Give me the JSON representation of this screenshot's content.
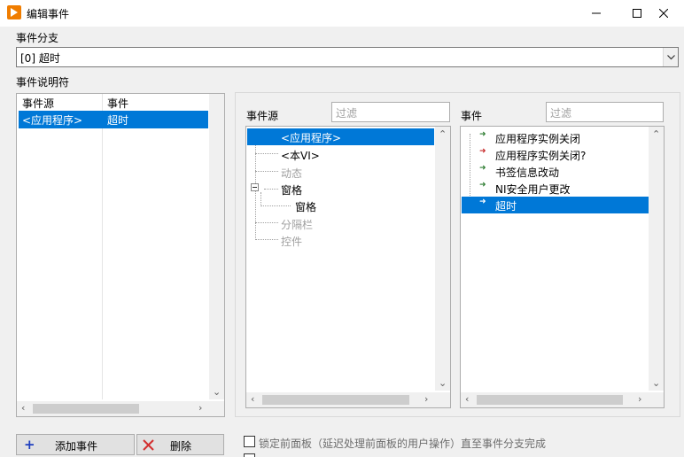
{
  "window": {
    "title": "编辑事件"
  },
  "event_case": {
    "label": "事件分支",
    "value": "[0] 超时"
  },
  "specifiers": {
    "label": "事件说明符",
    "col_source": "事件源",
    "col_event": "事件",
    "rows": [
      {
        "source": "<应用程序>",
        "event": "超时"
      }
    ]
  },
  "sources": {
    "label": "事件源",
    "filter_placeholder": "过滤",
    "items": [
      {
        "label": "<应用程序>",
        "selected": true,
        "dimmed": false
      },
      {
        "label": "<本VI>",
        "selected": false,
        "dimmed": false
      },
      {
        "label": "动态",
        "selected": false,
        "dimmed": true
      },
      {
        "label": "窗格",
        "selected": false,
        "dimmed": false
      },
      {
        "label": "窗格",
        "selected": false,
        "dimmed": false
      },
      {
        "label": "分隔栏",
        "selected": false,
        "dimmed": true
      },
      {
        "label": "控件",
        "selected": false,
        "dimmed": true
      }
    ]
  },
  "events": {
    "label": "事件",
    "filter_placeholder": "过滤",
    "items": [
      {
        "label": "应用程序实例关闭",
        "selected": false,
        "arrow_color": "#2e7d32"
      },
      {
        "label": "应用程序实例关闭?",
        "selected": false,
        "arrow_color": "#c62828"
      },
      {
        "label": "书签信息改动",
        "selected": false,
        "arrow_color": "#2e7d32"
      },
      {
        "label": "NI安全用户更改",
        "selected": false,
        "arrow_color": "#2e7d32"
      },
      {
        "label": "超时",
        "selected": true,
        "arrow_color": "#ffffff"
      }
    ]
  },
  "buttons": {
    "add": "添加事件",
    "delete": "删除"
  },
  "lock_front_panel": {
    "label": "锁定前面板（延迟处理前面板的用户操作）直至事件分支完成",
    "checked": false
  },
  "colors": {
    "selection": "#0078d7",
    "app_icon": "#f07d00"
  }
}
